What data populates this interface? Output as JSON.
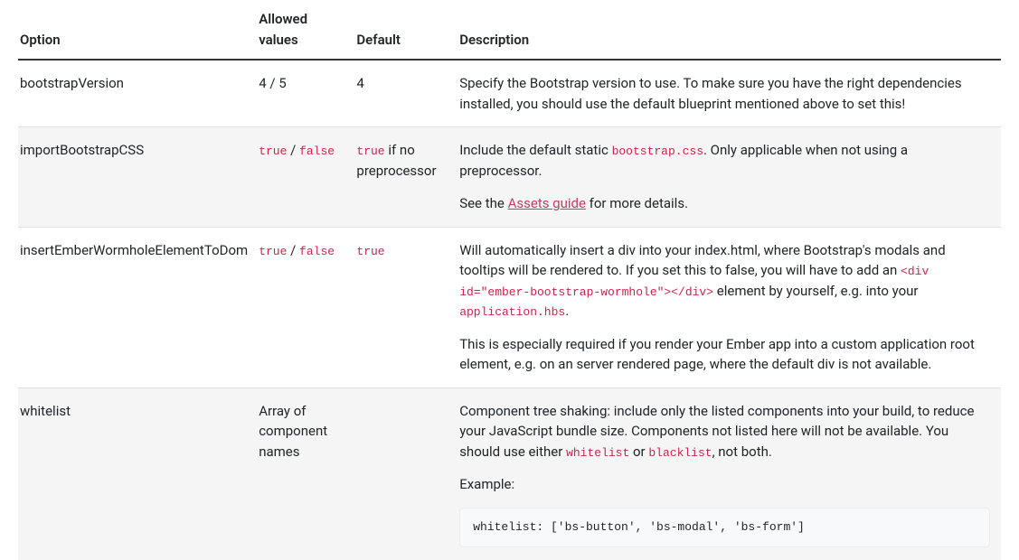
{
  "headers": {
    "option": "Option",
    "allowed": "Allowed values",
    "default": "Default",
    "description": "Description"
  },
  "rows": {
    "r0": {
      "option": "bootstrapVersion",
      "allowed": "4 / 5",
      "default": "4",
      "desc": "Specify the Bootstrap version to use. To make sure you have the right dependencies installed, you should use the default blueprint mentioned above to set this!"
    },
    "r1": {
      "option": "importBootstrapCSS",
      "allowed_a": "true",
      "allowed_sep": " / ",
      "allowed_b": "false",
      "default_a": "true",
      "default_b": " if no preprocessor",
      "desc_pre": "Include the default static ",
      "desc_code": "bootstrap.css",
      "desc_post": ". Only applicable when not using a preprocessor.",
      "see_pre": "See the ",
      "see_link": "Assets guide",
      "see_post": " for more details."
    },
    "r2": {
      "option": "insertEmberWormholeElementToDom",
      "allowed_a": "true",
      "allowed_sep": " / ",
      "allowed_b": "false",
      "default": "true",
      "p1_a": "Will automatically insert a div into your index.html, where Bootstrap's modals and tooltips will be rendered to. If you set this to false, you will have to add an ",
      "p1_code1": "<div id=\"ember-bootstrap-wormhole\"></div>",
      "p1_b": " element by yourself, e.g. into your ",
      "p1_code2": "application.hbs",
      "p1_c": ".",
      "p2": "This is especially required if you render your Ember app into a custom application root element, e.g. on an server rendered page, where the default div is not available."
    },
    "r3": {
      "option": "whitelist",
      "allowed": "Array of component names",
      "p1_a": "Component tree shaking: include only the listed components into your build, to reduce your JavaScript bundle size. Components not listed here will not be available. You should use either ",
      "p1_code1": "whitelist",
      "p1_b": " or ",
      "p1_code2": "blacklist",
      "p1_c": ", not both.",
      "example_label": "Example:",
      "example_code": "whitelist: ['bs-button', 'bs-modal', 'bs-form']"
    }
  }
}
